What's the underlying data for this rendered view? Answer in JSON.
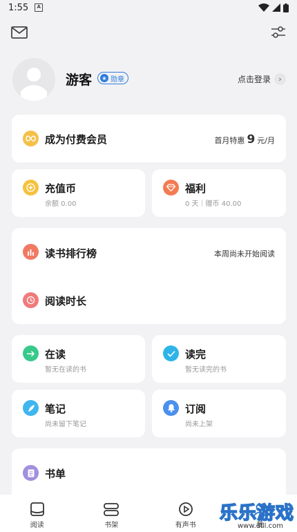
{
  "status_bar": {
    "time": "1:55",
    "a_icon": "A"
  },
  "profile": {
    "username": "游客",
    "badge": "勋章",
    "login_text": "点击登录"
  },
  "vip": {
    "title": "成为付费会员",
    "price_prefix": "首月特惠",
    "price_value": "9",
    "price_suffix": "元/月",
    "icon_color": "#f5c04a"
  },
  "recharge": {
    "title": "充值币",
    "subtitle": "余额 0.00",
    "icon_color": "#f5c23e"
  },
  "welfare": {
    "title": "福利",
    "subtitle": "0 天｜赠币 40.00",
    "icon_color": "#f47a51"
  },
  "ranking": {
    "title": "读书排行榜",
    "right_text": "本周尚未开始阅读",
    "icon_color": "#f07a62"
  },
  "reading_time": {
    "title": "阅读时长",
    "icon_color": "#f07b7b"
  },
  "reading": {
    "title": "在读",
    "subtitle": "暂无在读的书",
    "icon_color": "#38c98b"
  },
  "finished": {
    "title": "读完",
    "subtitle": "暂无读完的书",
    "icon_color": "#2fb4e8"
  },
  "notes": {
    "title": "笔记",
    "subtitle": "尚未留下笔记",
    "icon_color": "#3fb6ef"
  },
  "subscriptions": {
    "title": "订阅",
    "subtitle": "尚未上架",
    "icon_color": "#4c90ee"
  },
  "booklist": {
    "title": "书单",
    "icon_color": "#a18fe0"
  },
  "bottom_nav": [
    {
      "label": "阅读",
      "icon": "read-icon"
    },
    {
      "label": "书架",
      "icon": "bookshelf-icon"
    },
    {
      "label": "有声书",
      "icon": "audiobook-icon"
    },
    {
      "label": "我",
      "icon": "me-icon"
    }
  ],
  "watermark": {
    "text": "乐乐游戏",
    "url": "www.dlll.com"
  }
}
